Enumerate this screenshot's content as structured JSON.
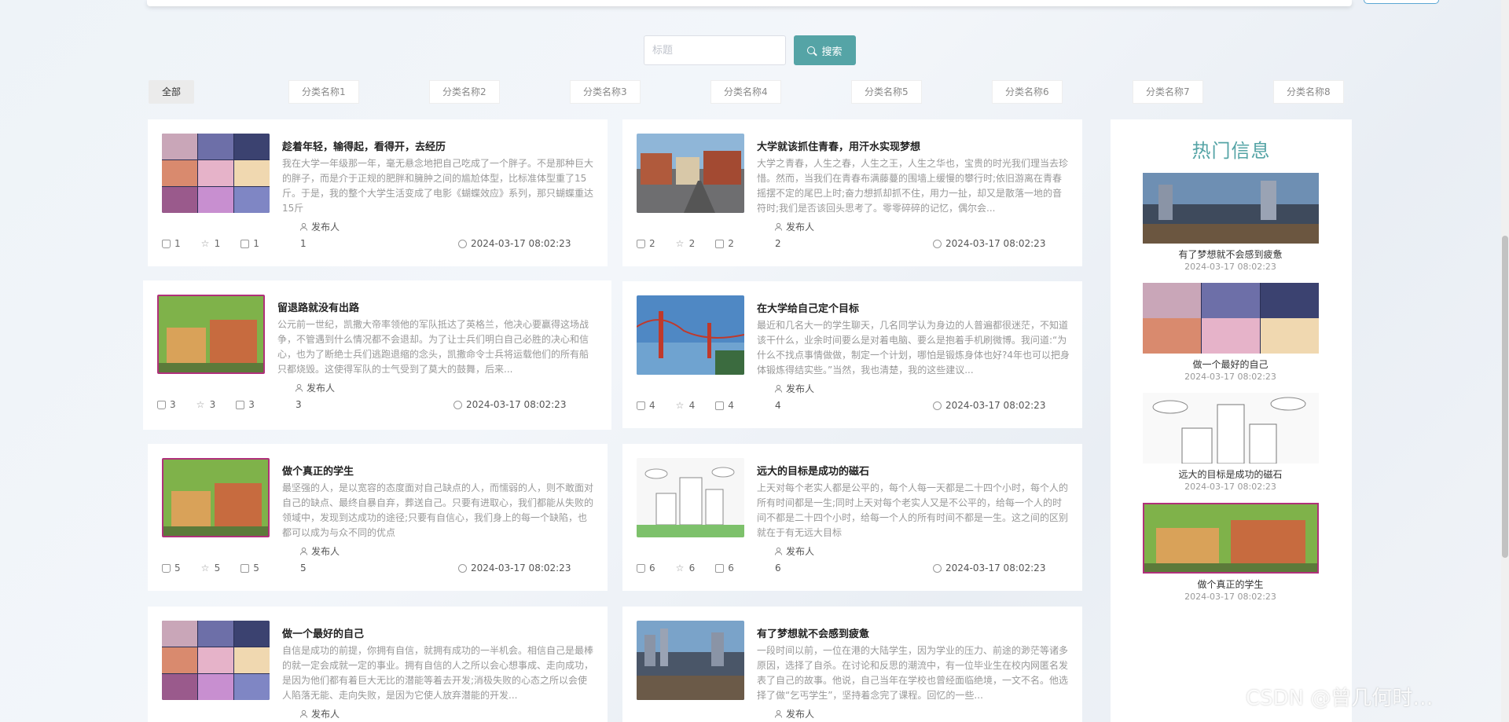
{
  "search": {
    "placeholder": "标题",
    "button_label": "搜索"
  },
  "categories": [
    {
      "label": "全部",
      "active": true
    },
    {
      "label": "分类名称1"
    },
    {
      "label": "分类名称2"
    },
    {
      "label": "分类名称3"
    },
    {
      "label": "分类名称4"
    },
    {
      "label": "分类名称5"
    },
    {
      "label": "分类名称6"
    },
    {
      "label": "分类名称7"
    },
    {
      "label": "分类名称8"
    }
  ],
  "cards": [
    {
      "title": "趁着年轻，输得起，看得开，去经历",
      "excerpt": "我在大学一年级那一年，毫无悬念地把自己吃成了一个胖子。不是那种巨大的胖子，而是介于正规的肥胖和臃肿之间的尴尬体型，比标准体型重了15斤。于是，我的整个大学生活变成了电影《蝴蝶效应》系列，那只蝴蝶重达15斤",
      "publisher": "发布人",
      "likes": "1",
      "favorites": "1",
      "comments": "1",
      "count": "1",
      "date": "2024-03-17 08:02:23"
    },
    {
      "title": "大学就该抓住青春，用汗水实现梦想",
      "excerpt": "大学之青春，人生之春，人生之王，人生之华也，宝贵的时光我们理当去珍惜。然而，当我们在青春布满藤蔓的围墙上缓慢的攀行时;依旧游离在青春摇摆不定的尾巴上时;奋力想抓却抓不住，用力一扯，却又是散落一地的音符时;我们是否该回头思考了。零零碎碎的记忆，偶尔会...",
      "publisher": "发布人",
      "likes": "2",
      "favorites": "2",
      "comments": "2",
      "count": "2",
      "date": "2024-03-17 08:02:23"
    },
    {
      "title": "留退路就没有出路",
      "excerpt": "公元前一世纪，凯撒大帝率领他的军队抵达了英格兰，他决心要赢得这场战争，不管遇到什么情况都不会退却。为了让士兵们明白自己必胜的决心和信心，也为了断绝士兵们逃跑退缩的念头，凯撒命令士兵将运载他们的所有船只都烧毁。这使得军队的士气受到了莫大的鼓舞，后来...",
      "publisher": "发布人",
      "likes": "3",
      "favorites": "3",
      "comments": "3",
      "count": "3",
      "date": "2024-03-17 08:02:23"
    },
    {
      "title": "在大学给自己定个目标",
      "excerpt": "最近和几名大一的学生聊天，几名同学认为身边的人普遍都很迷茫，不知道该干什么，业余时间要么是对着电脑、要么是抱着手机刷微博。我问道:“为什么不找点事情做做，制定一个计划，哪怕是锻炼身体也好?4年也可以把身体锻炼得结实些。”当然，我也清楚，我的这些建议...",
      "publisher": "发布人",
      "likes": "4",
      "favorites": "4",
      "comments": "4",
      "count": "4",
      "date": "2024-03-17 08:02:23"
    },
    {
      "title": "做个真正的学生",
      "excerpt": "最坚强的人，是以宽容的态度面对自己缺点的人，而懦弱的人，则不敢面对自己的缺点、最终自暴自弃，葬送自己。只要有进取心，我们都能从失败的领域中，发现到达成功的途径;只要有自信心，我们身上的每一个缺陷，也都可以成为与众不同的优点",
      "publisher": "发布人",
      "likes": "5",
      "favorites": "5",
      "comments": "5",
      "count": "5",
      "date": "2024-03-17 08:02:23"
    },
    {
      "title": "远大的目标是成功的磁石",
      "excerpt": "上天对每个老实人都是公平的，每个人每一天都是二十四个小时，每个人的所有时间都是一生;同时上天对每个老实人又是不公平的，给每一个人的时间不都是二十四个小时，给每一个人的所有时间不都是一生。这之间的区别就在于有无远大目标",
      "publisher": "发布人",
      "likes": "6",
      "favorites": "6",
      "comments": "6",
      "count": "6",
      "date": "2024-03-17 08:02:23"
    },
    {
      "title": "做一个最好的自己",
      "excerpt": "自信是成功的前提，你拥有自信，就拥有成功的一半机会。相信自己是最棒的就一定会成就一定的事业。拥有自信的人之所以会心想事成、走向成功，是因为他们都有着巨大无比的潜能等着去开发;消极失败的心态之所以会使人陷落无能、走向失败，是因为它使人放弃潜能的开发...",
      "publisher": "发布人"
    },
    {
      "title": "有了梦想就不会感到疲惫",
      "excerpt": "一段时间以前，一位在港的大陆学生，因为学业的压力、前途的渺茫等诸多原因，选择了自杀。在讨论和反思的潮流中，有一位毕业生在校内网匿名发表了自己的故事。他说，自己当年在学校也曾经面临绝境，一文不名。他选择了做“乞丐学生”，坚持着念完了课程。回忆的一些...",
      "publisher": "发布人"
    }
  ],
  "sidebar": {
    "title": "热门信息",
    "items": [
      {
        "name": "有了梦想就不会感到疲惫",
        "date": "2024-03-17 08:02:23"
      },
      {
        "name": "做一个最好的自己",
        "date": "2024-03-17 08:02:23"
      },
      {
        "name": "远大的目标是成功的磁石",
        "date": "2024-03-17 08:02:23"
      },
      {
        "name": "做个真正的学生",
        "date": "2024-03-17 08:02:23"
      }
    ]
  },
  "watermark": "CSDN @曾几何时…",
  "colors": {
    "accent": "#55a4a6",
    "title": "#222222",
    "excerpt": "#999999"
  }
}
